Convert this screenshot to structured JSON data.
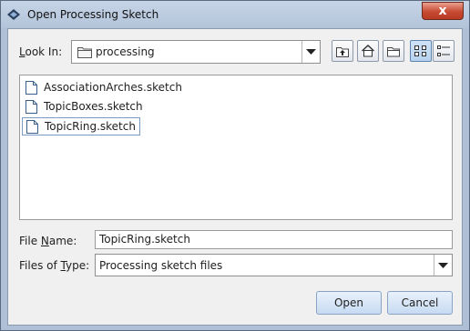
{
  "window": {
    "title": "Open Processing Sketch",
    "close_glyph": "x"
  },
  "lookin": {
    "label": "Look In:",
    "value": "processing"
  },
  "files": [
    {
      "name": "AssociationArches.sketch",
      "icon": "document-icon",
      "selected": false
    },
    {
      "name": "TopicBoxes.sketch",
      "icon": "document-icon",
      "selected": false
    },
    {
      "name": "TopicRing.sketch",
      "icon": "document-icon",
      "selected": true
    }
  ],
  "filename": {
    "label": "File Name:",
    "value": "TopicRing.sketch"
  },
  "filetype": {
    "label": "Files of Type:",
    "value": "Processing sketch files"
  },
  "buttons": {
    "open": "Open",
    "cancel": "Cancel"
  },
  "toolbar": {
    "up_folder": "up-folder-icon",
    "home": "home-icon",
    "new_folder": "new-folder-icon",
    "list_view": "list-view-icon",
    "details_view": "details-view-icon"
  },
  "colors": {
    "selection_border": "#7a9cc4",
    "button_face": "#c7dbf2",
    "close_button": "#c74a33"
  }
}
